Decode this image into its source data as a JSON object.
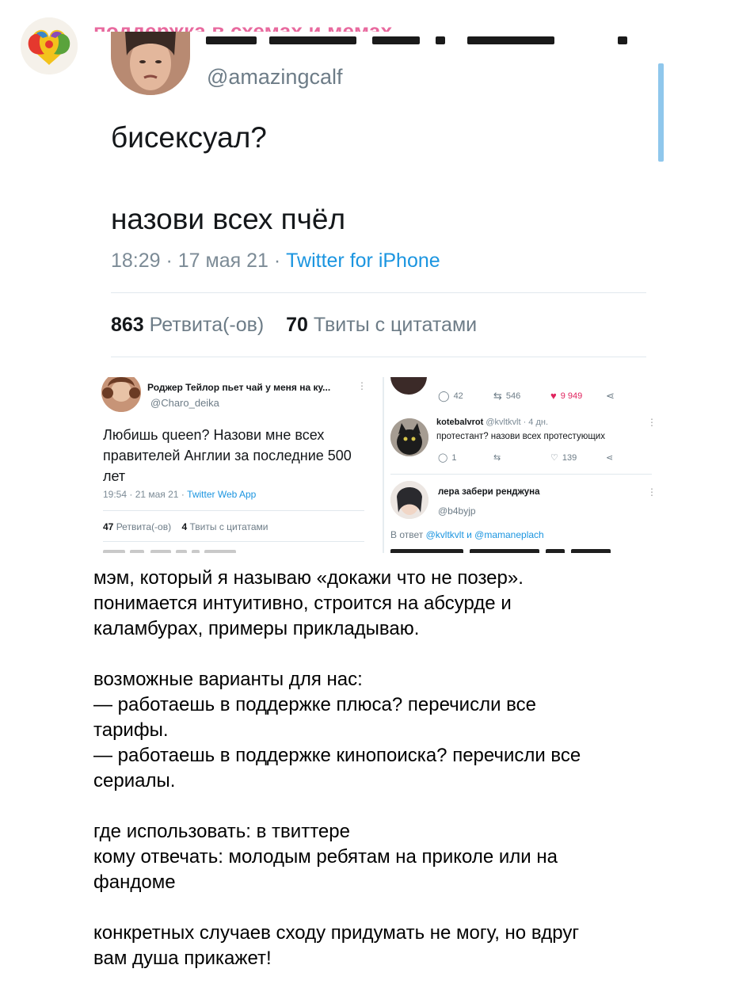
{
  "channel": {
    "name": "поддержка в схемах и мемах",
    "avatar_label": "Communication Clown To Clown Conversation"
  },
  "main_tweet": {
    "handle": "@amazingcalf",
    "line1": "бисексуал?",
    "line2": "назови всех пчёл",
    "time_date": "18:29 · 17 мая 21 · ",
    "source": "Twitter for iPhone",
    "retweets_count": "863",
    "retweets_label": "Ретвита(-ов)",
    "quotes_count": "70",
    "quotes_label": "Твиты с цитатами"
  },
  "left_tweet": {
    "name": "Роджер Тейлор пьет чай у меня на ку...",
    "handle": "@Charo_deika",
    "text": "Любишь queen? Назови мне всех правителей Англии за последние 500 лет",
    "time_date": "19:54 · 21 мая 21 · ",
    "source": "Twitter Web App",
    "retweets_count": "47",
    "retweets_label": "Ретвита(-ов)",
    "quotes_count": "4",
    "quotes_label": "Твиты с цитатами",
    "more_icon": "more-vertical-icon"
  },
  "right_thread": {
    "top_actions": {
      "replies": "42",
      "retweets": "546",
      "likes": "9 949"
    },
    "reply1": {
      "name": "kotebalvrot",
      "handle_time": "@kvltkvlt · 4 дн.",
      "text": "протестант? назови всех протестующих",
      "replies": "1",
      "likes": "139"
    },
    "reply2": {
      "name": "лера забери ренджуна",
      "handle": "@b4byjp",
      "reply_prefix": "В ответ ",
      "reply_to": "@kvltkvlt и @mamaneplach"
    },
    "colors": {
      "like": "#e0245e",
      "link": "#1b95e0"
    }
  },
  "post": {
    "p1": [
      "мэм, который я называю «докажи что не позер».",
      "понимается интуитивно, строится на абсурде и",
      "каламбурах, примеры прикладываю."
    ],
    "p2": [
      "возможные варианты для нас:",
      "— работаешь в поддержке плюса? перечисли все",
      "тарифы.",
      "— работаешь в поддержке кинопоиска? перечисли все",
      "сериалы."
    ],
    "p3": [
      "где использовать: в твиттере",
      "кому отвечать: молодым ребятам на приколе или на",
      "фандоме"
    ],
    "p4": [
      "конкретных случаев сходу придумать не могу, но вдруг",
      "вам душа прикажет!"
    ]
  },
  "colors": {
    "channel_name": "#e8699e",
    "twitter_blue": "#1b95e0",
    "muted": "#6d7c87"
  }
}
